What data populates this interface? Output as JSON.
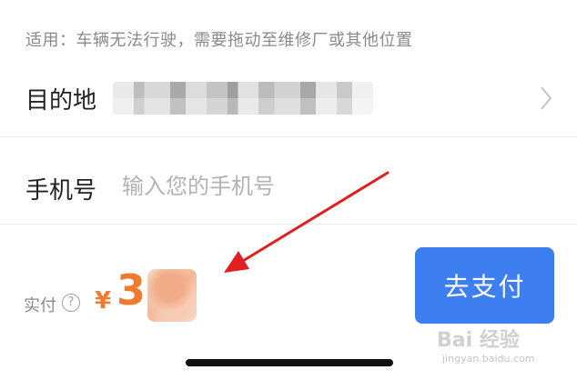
{
  "hint": "适用：车辆无法行驶，需要拖动至维修厂或其他位置",
  "destination": {
    "label": "目的地",
    "chevron_icon": "chevron-right-icon"
  },
  "phone": {
    "label": "手机号",
    "placeholder": "输入您的手机号"
  },
  "payment": {
    "label": "实付",
    "help_icon": "question-circle-icon",
    "help_glyph": "?",
    "currency": "¥",
    "amount_visible": "3",
    "button_label": "去支付"
  },
  "watermark": {
    "main": "Bai 经验",
    "sub": "jingyan.baidu.com"
  },
  "colors": {
    "accent_orange": "#f07a2f",
    "button_blue": "#3d7ef0",
    "annotation_red": "#e02020",
    "hint_gray": "#8a8a8a",
    "placeholder_gray": "#b3b3b3"
  }
}
